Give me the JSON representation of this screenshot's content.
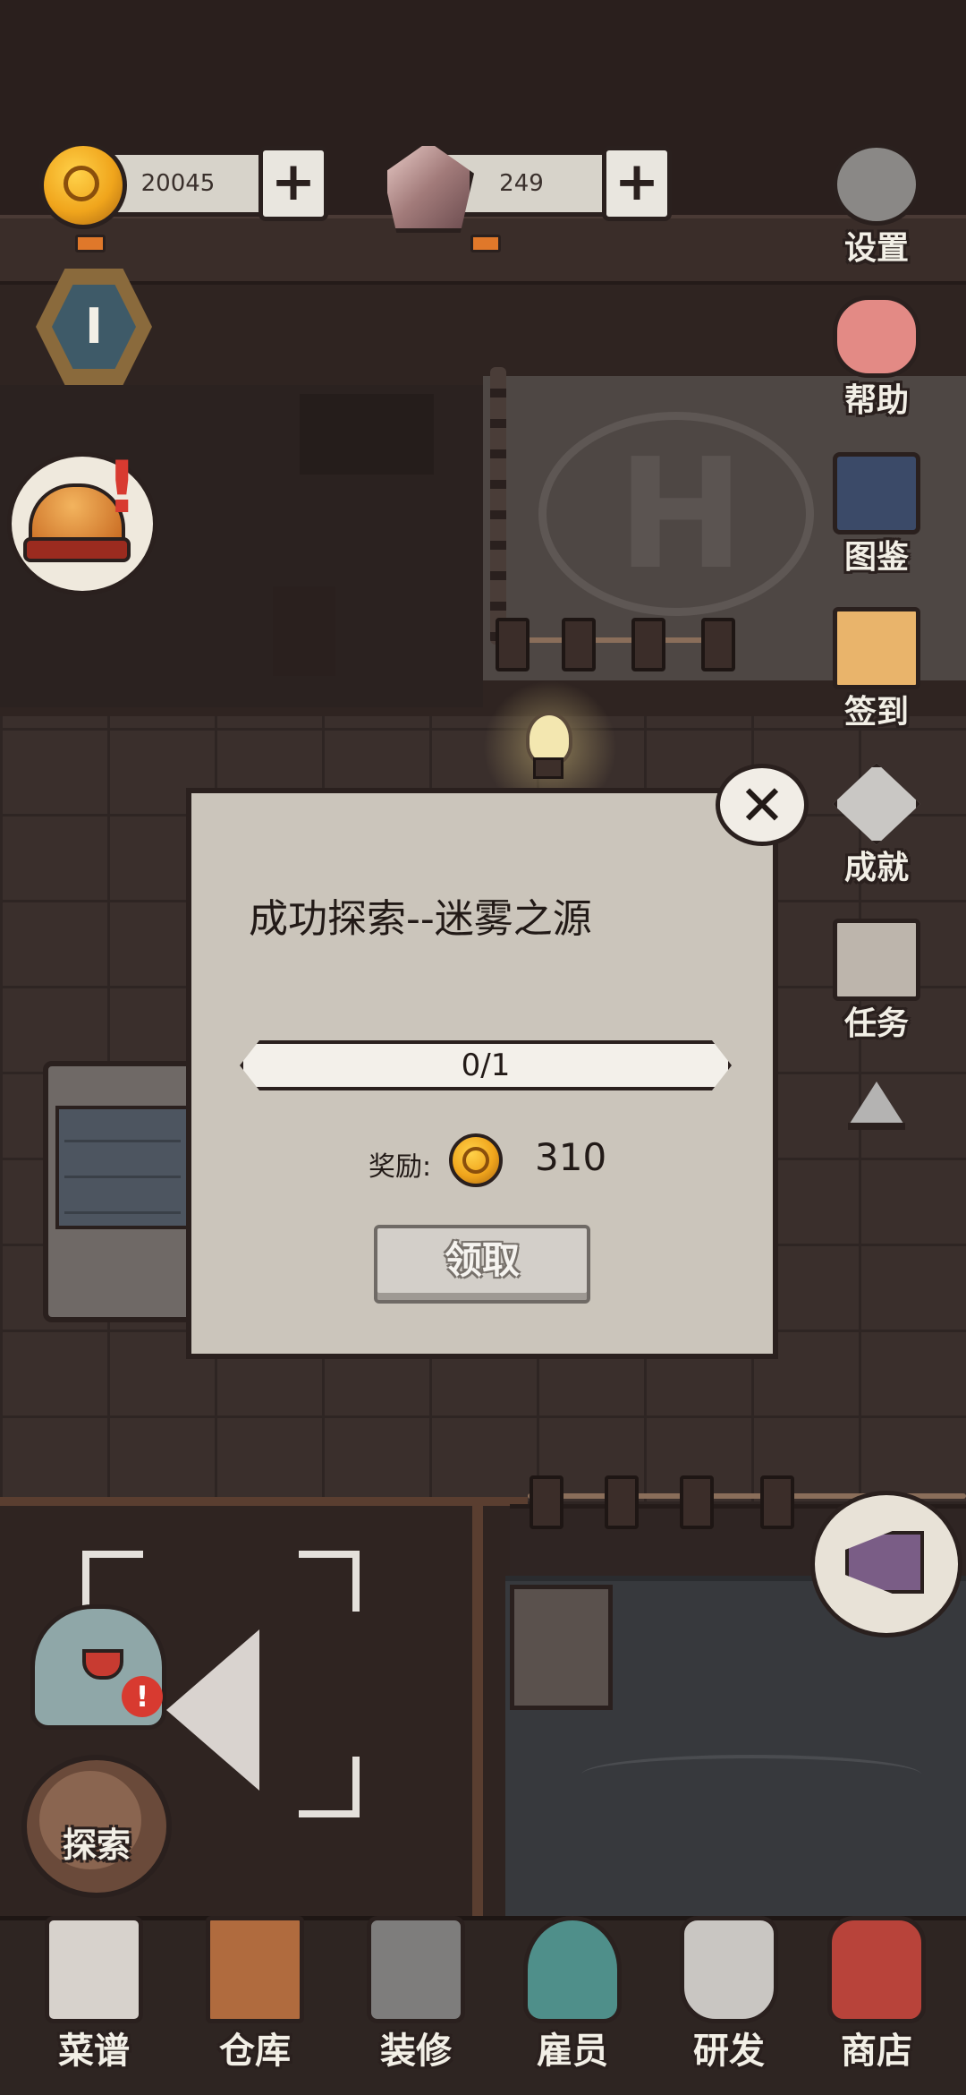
{
  "currency": {
    "coins": "20045",
    "gems": "249",
    "plus": "+"
  },
  "level": {
    "value": "I"
  },
  "side_menu": {
    "settings": "设置",
    "help": "帮助",
    "collection": "图鉴",
    "checkin": "签到",
    "achievements": "成就",
    "tasks": "任务"
  },
  "explore": {
    "label": "探索"
  },
  "ghost_alert": "!",
  "bell_alert": "!",
  "bottom_nav": [
    {
      "label": "菜谱",
      "icon": "recipe-scroll-icon"
    },
    {
      "label": "仓库",
      "icon": "warehouse-cabinet-icon"
    },
    {
      "label": "装修",
      "icon": "hammer-icon"
    },
    {
      "label": "雇员",
      "icon": "employee-icon"
    },
    {
      "label": "研发",
      "icon": "cooking-pot-icon"
    },
    {
      "label": "商店",
      "icon": "shop-bag-icon"
    }
  ],
  "dialog": {
    "title": "成功探索--迷雾之源",
    "progress_text": "0/1",
    "progress_fraction": 0,
    "reward_label": "奖励:",
    "reward_amount": "310",
    "claim_label": "领取",
    "close_symbol": "✕"
  },
  "colors": {
    "coin_gold": "#f0a51c",
    "alert_red": "#d83a30",
    "panel": "#cbc5bb",
    "outline": "#2a201e"
  }
}
